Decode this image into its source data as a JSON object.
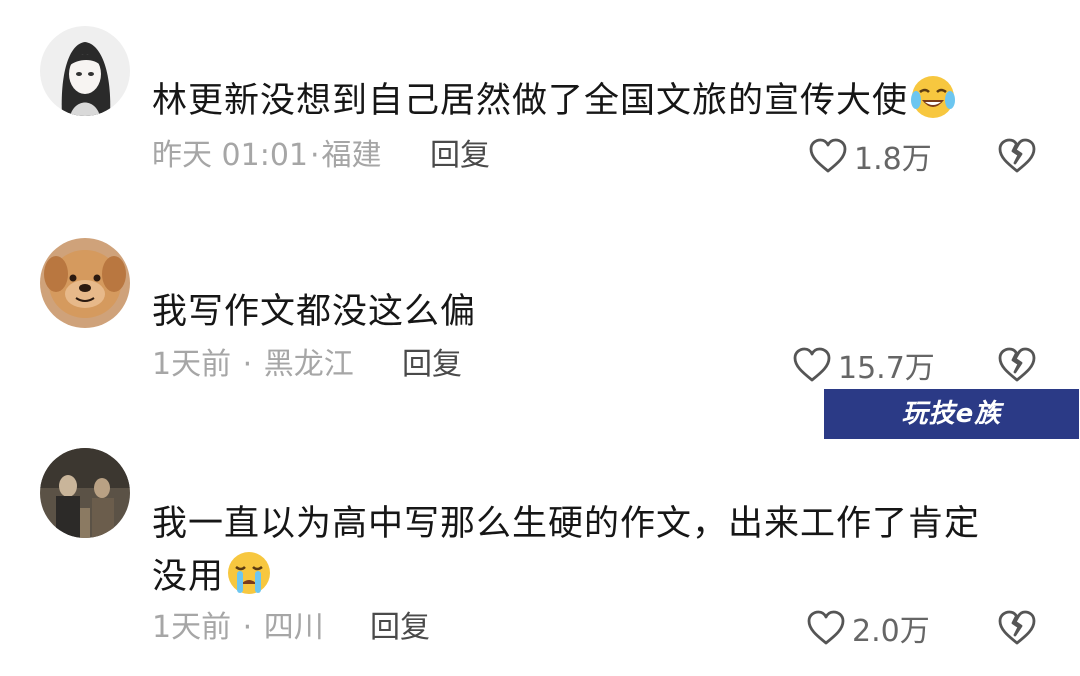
{
  "comments": [
    {
      "avatar": "anime-girl-avatar",
      "text": "林更新没想到自己居然做了全国文旅的宣传大使",
      "emoji": "laughing-crying-emoji",
      "time": "昨天 01:01",
      "location": "福建",
      "reply_label": "回复",
      "likes": "1.8万"
    },
    {
      "avatar": "puppy-avatar",
      "text": "我写作文都没这么偏",
      "emoji": "",
      "time": "1天前",
      "location": "黑龙江",
      "reply_label": "回复",
      "likes": "15.7万"
    },
    {
      "avatar": "movie-still-avatar",
      "text_line1": "我一直以为高中写那么生硬的作文，出来工作了肯定",
      "text_line2": "没用",
      "emoji": "crying-emoji",
      "time": "1天前",
      "location": "四川",
      "reply_label": "回复",
      "likes": "2.0万"
    }
  ],
  "watermark": "玩技e族",
  "colors": {
    "meta": "#a6a6a6",
    "text": "#161616",
    "icon": "#555555",
    "watermark_bg": "#2b3a86"
  }
}
